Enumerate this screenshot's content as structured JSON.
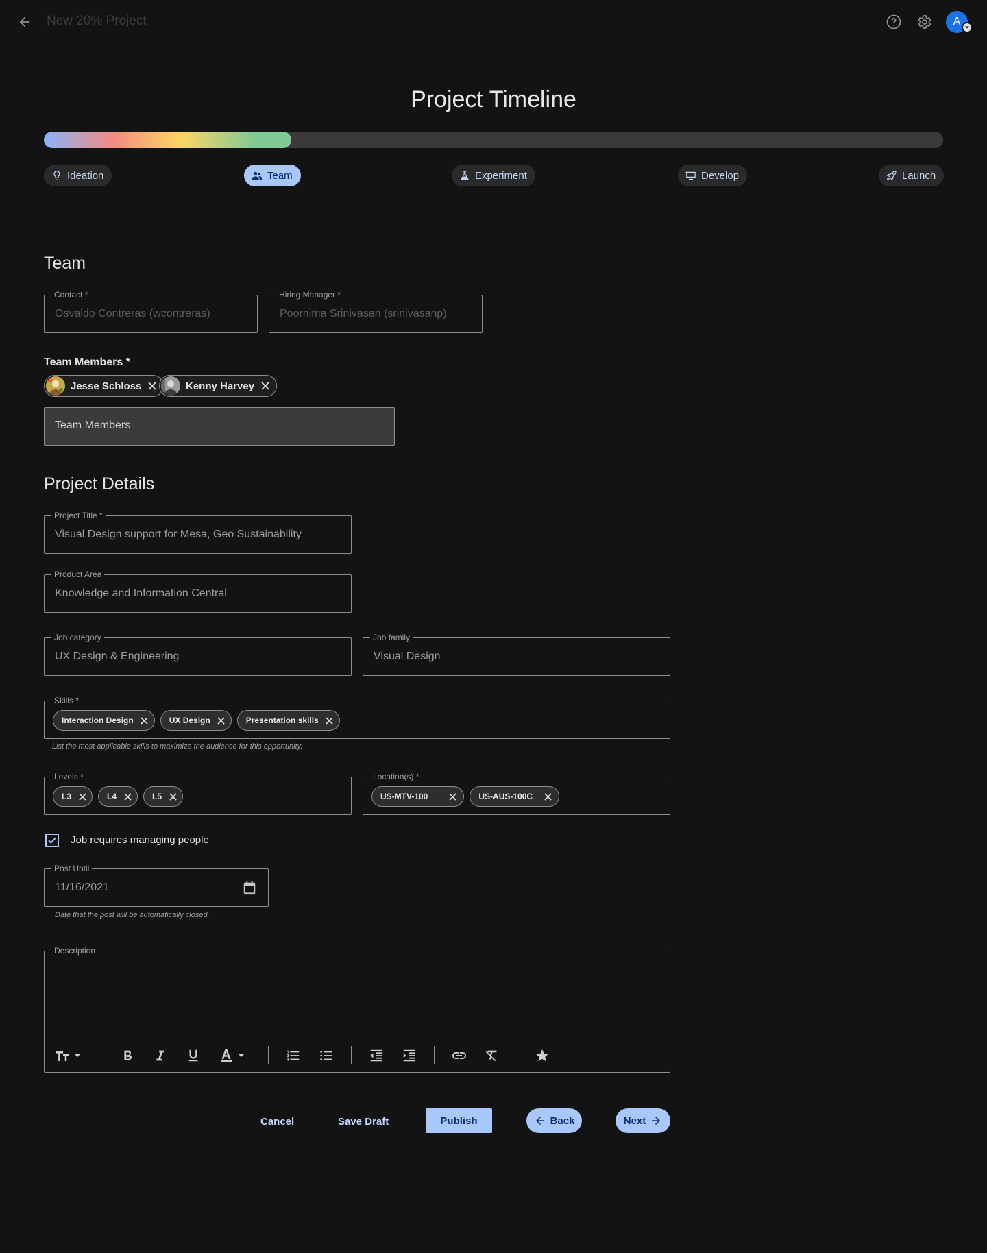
{
  "app": {
    "title": "New 20% Project"
  },
  "timeline": {
    "heading": "Project Timeline",
    "progress": 0.275,
    "stages": [
      {
        "label": "Ideation",
        "icon": "lightbulb-icon",
        "active": false
      },
      {
        "label": "Team",
        "icon": "group-icon",
        "active": true
      },
      {
        "label": "Experiment",
        "icon": "flask-icon",
        "active": false
      },
      {
        "label": "Develop",
        "icon": "monitor-icon",
        "active": false
      },
      {
        "label": "Launch",
        "icon": "rocket-icon",
        "active": false
      }
    ]
  },
  "team": {
    "title": "Team",
    "contact": {
      "label": "Contact *",
      "value": "Osvaldo Contreras (wcontreras)"
    },
    "hiring_manager": {
      "label": "Hiring Manager *",
      "value": "Poornima Srinivasan (srinivasanp)"
    },
    "members_label": "Team Members *",
    "members": [
      {
        "name": "Jesse Schloss"
      },
      {
        "name": "Kenny Harvey"
      }
    ],
    "members_input_placeholder": "Team Members"
  },
  "details": {
    "title": "Project Details",
    "project_title": {
      "label": "Project Title *",
      "value": "Visual Design support for Mesa, Geo Sustainability"
    },
    "product_area": {
      "label": "Product Area",
      "value": "Knowledge and Information Central"
    },
    "job_category": {
      "label": "Job category",
      "value": "UX Design & Engineering"
    },
    "job_family": {
      "label": "Job family",
      "value": "Visual Design"
    },
    "skills": {
      "label": "Skills *",
      "chips": [
        "Interaction Design",
        "UX Design",
        "Presentation skills"
      ],
      "hint": "List the most applicable skills to maximize the audience for this opportunity."
    },
    "levels": {
      "label": "Levels *",
      "chips": [
        "L3",
        "L4",
        "L5"
      ]
    },
    "locations": {
      "label": "Location(s) *",
      "chips": [
        "US-MTV-100",
        "US-AUS-100C"
      ]
    },
    "managing_people": {
      "label": "Job requires managing people",
      "checked": true
    },
    "post_until": {
      "label": "Post Until",
      "value": "11/16/2021",
      "hint": "Date that the post will be automatically closed."
    },
    "description": {
      "label": "Description",
      "value": ""
    }
  },
  "actions": {
    "cancel": "Cancel",
    "save_draft": "Save Draft",
    "publish": "Publish",
    "back": "Back",
    "next": "Next"
  },
  "colors": {
    "background": "#131313",
    "accent": "#a8c7fa",
    "avatar": "#1a73e8"
  }
}
